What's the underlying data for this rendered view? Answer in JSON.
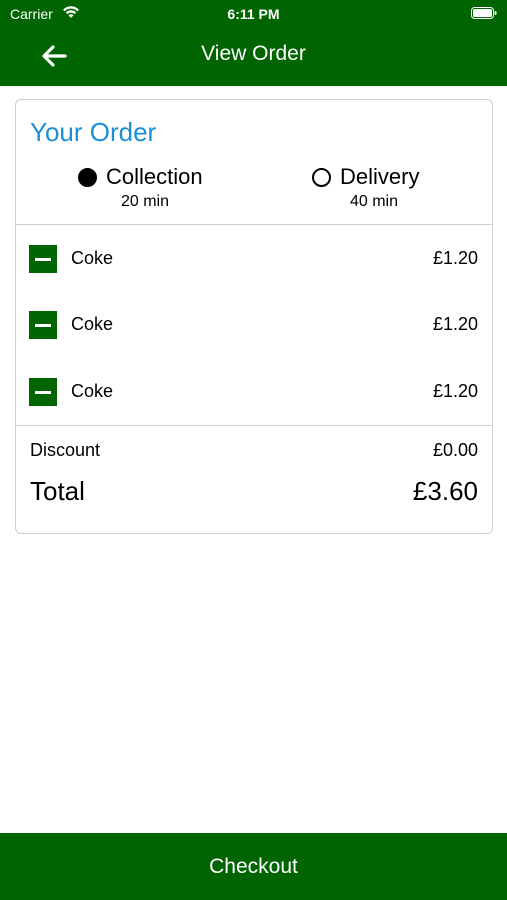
{
  "status_bar": {
    "carrier": "Carrier",
    "time": "6:11 PM"
  },
  "header": {
    "title": "View Order",
    "back_icon": "arrow-left-icon"
  },
  "order": {
    "heading": "Your Order",
    "options": [
      {
        "label": "Collection",
        "time": "20 min",
        "selected": true
      },
      {
        "label": "Delivery",
        "time": "40 min",
        "selected": false
      }
    ],
    "items": [
      {
        "name": "Coke",
        "price": "£1.20"
      },
      {
        "name": "Coke",
        "price": "£1.20"
      },
      {
        "name": "Coke",
        "price": "£1.20"
      }
    ],
    "discount_label": "Discount",
    "discount_value": "£0.00",
    "total_label": "Total",
    "total_value": "£3.60"
  },
  "footer": {
    "checkout_label": "Checkout"
  },
  "colors": {
    "brand_green": "#006400",
    "heading_blue": "#1a8fd6"
  }
}
